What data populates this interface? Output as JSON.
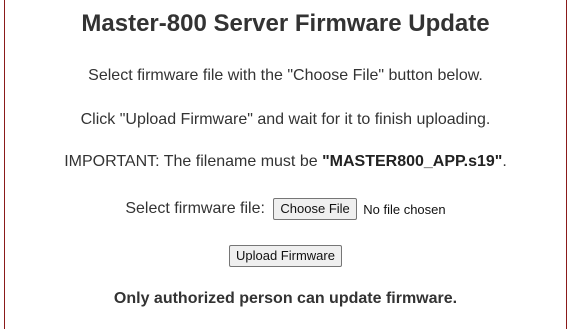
{
  "page": {
    "title": "Master-800 Server Firmware Update",
    "instructions": {
      "line1": "Select firmware file with the \"Choose File\" button below.",
      "line2": "Click \"Upload Firmware\" and wait for it to finish uploading.",
      "line3_prefix": "IMPORTANT: The filename must be ",
      "line3_filename": "\"MASTER800_APP.s19\"",
      "line3_suffix": "."
    },
    "file_input": {
      "label": "Select firmware file:",
      "button_label": "Choose File",
      "status": "No file chosen"
    },
    "upload_button_label": "Upload Firmware",
    "notice": "Only authorized person can update firmware."
  },
  "colors": {
    "frame_border": "#8b1a1a",
    "text": "#333333",
    "button_bg": "#efefef"
  }
}
